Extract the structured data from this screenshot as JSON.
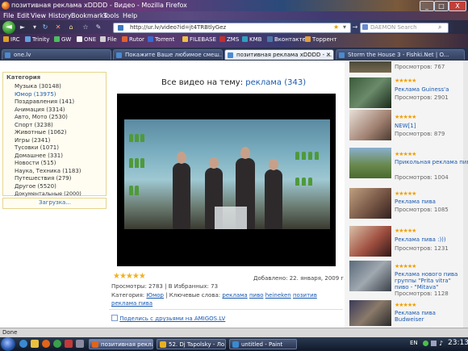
{
  "window": {
    "title": "позитивная реклама xDDDD - Видео - Mozilla Firefox",
    "minimize": "_",
    "maximize": "□",
    "close": "X"
  },
  "menu": [
    "File",
    "Edit",
    "View",
    "History",
    "Bookmarks",
    "Tools",
    "Help"
  ],
  "nav": {
    "back_icon": "◄",
    "forward_icon": "►",
    "url": "http://ur.lv/video?id=jt4TRBtlyGez",
    "search_placeholder": "DAEMON Search"
  },
  "bookmarks": [
    "IRC",
    "Trinity",
    "GW",
    "ONE",
    "File",
    "Rutor",
    "Torrent",
    "FILEBASE",
    "ZMS",
    "KMB",
    "Вконтакте",
    "Торрент"
  ],
  "tabs": [
    {
      "label": "one.lv",
      "active": false
    },
    {
      "label": "Покажите Ваше любимое смеш...",
      "active": false
    },
    {
      "label": "позитивная реклама xDDDD - ...",
      "active": true
    },
    {
      "label": "Storm the House 3 - Fishki.Net | O...",
      "active": false
    }
  ],
  "sidebar": {
    "header": "Категория",
    "categories": [
      {
        "label": "Музыка (30148)",
        "selected": false
      },
      {
        "label": "Юмор (13975)",
        "selected": true
      },
      {
        "label": "Поздравления (141)",
        "selected": false
      },
      {
        "label": "Анимация (3314)",
        "selected": false
      },
      {
        "label": "Авто, Мото (2530)",
        "selected": false
      },
      {
        "label": "Спорт (3238)",
        "selected": false
      },
      {
        "label": "Животные (1062)",
        "selected": false
      },
      {
        "label": "Игры (2341)",
        "selected": false
      },
      {
        "label": "Тусовки (1071)",
        "selected": false
      },
      {
        "label": "Домашнее (331)",
        "selected": false
      },
      {
        "label": "Новости (515)",
        "selected": false
      },
      {
        "label": "Наука, Техника (1183)",
        "selected": false
      },
      {
        "label": "Путешествия (279)",
        "selected": false
      },
      {
        "label": "Другое (5520)",
        "selected": false
      },
      {
        "label": "Документальные (2000)",
        "selected": false
      }
    ],
    "loading": "Загрузка..."
  },
  "main": {
    "heading_prefix": "Все видео на тему:",
    "heading_topic": "реклама",
    "heading_count": "(343)",
    "rating_stars": 5,
    "added": "Добавлено: 22. января, 2009 г.",
    "views_label": "Просмотры:",
    "views": "2783",
    "fav_sep": "| В Избранных:",
    "favorites": "73",
    "category_label": "Категория:",
    "category": "Юмор",
    "keywords_label": "| Ключевые слова:",
    "keywords": [
      "реклама",
      "пиво",
      "heineken",
      "позитив",
      "реклама пива"
    ],
    "share": "Поделись с друзьями на AMIGOS.LV"
  },
  "related": [
    {
      "title": "",
      "views": "Просмотров: 767"
    },
    {
      "title": "Реклама Guiness'a",
      "views": "Просмотров: 2901"
    },
    {
      "title": "NEW[1]",
      "views": "Просмотров: 879"
    },
    {
      "title": "Прикольная реклама пива",
      "views": "Просмотров: 1004"
    },
    {
      "title": "Реклама пива",
      "views": "Просмотров: 1085"
    },
    {
      "title": "Реклама пива :)))",
      "views": "Просмотров: 1231"
    },
    {
      "title": "Реклама нового пива группы \"Prita vitra\" пиво - \"Mitava\"",
      "views": "Просмотров: 1128"
    },
    {
      "title": "Реклама пива Budweiser",
      "views": ""
    }
  ],
  "status": "Done",
  "taskbar": {
    "items": [
      {
        "label": "позитивная реклама...",
        "active": true,
        "color": "#e0641a"
      },
      {
        "label": "52. Dj Tapolsky - Ло...",
        "active": false,
        "color": "#e8b020"
      },
      {
        "label": "untitled - Paint",
        "active": false,
        "color": "#3a8ad0"
      }
    ],
    "lang": "EN",
    "clock": "23:13"
  },
  "colors": {
    "accent": "#1a5ab0",
    "star": "#f0b020",
    "panel_border": "#e6d58a"
  }
}
